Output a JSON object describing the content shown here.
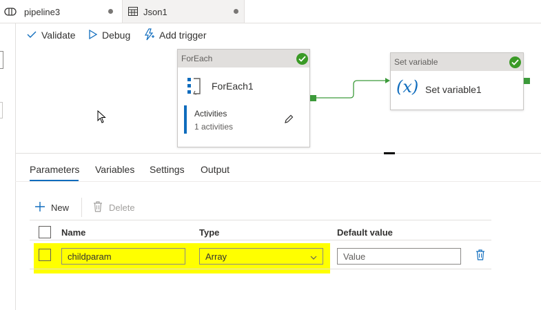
{
  "tabs": [
    {
      "label": "pipeline3",
      "icon": "pipeline-icon",
      "unsaved": true
    },
    {
      "label": "Json1",
      "icon": "table-icon",
      "unsaved": true
    }
  ],
  "toolbar": {
    "validate_label": "Validate",
    "debug_label": "Debug",
    "add_trigger_label": "Add trigger"
  },
  "canvas": {
    "foreach": {
      "header": "ForEach",
      "name": "ForEach1",
      "activities_label": "Activities",
      "activities_count": "1 activities",
      "status": "succeeded"
    },
    "setvariable": {
      "header": "Set variable",
      "name": "Set variable1",
      "glyph": "(x)",
      "status": "succeeded"
    }
  },
  "properties": {
    "tabs": [
      "Parameters",
      "Variables",
      "Settings",
      "Output"
    ],
    "active_tab": "Parameters",
    "actions": {
      "new_label": "New",
      "delete_label": "Delete"
    },
    "columns": [
      "Name",
      "Type",
      "Default value"
    ],
    "rows": [
      {
        "name": "childparam",
        "type": "Array",
        "default_placeholder": "Value",
        "highlighted": true
      }
    ]
  },
  "colors": {
    "accent": "#0f6cbd",
    "success": "#3a9a26",
    "highlight": "#ffff00",
    "activity_bar": "#0f6cbd"
  }
}
